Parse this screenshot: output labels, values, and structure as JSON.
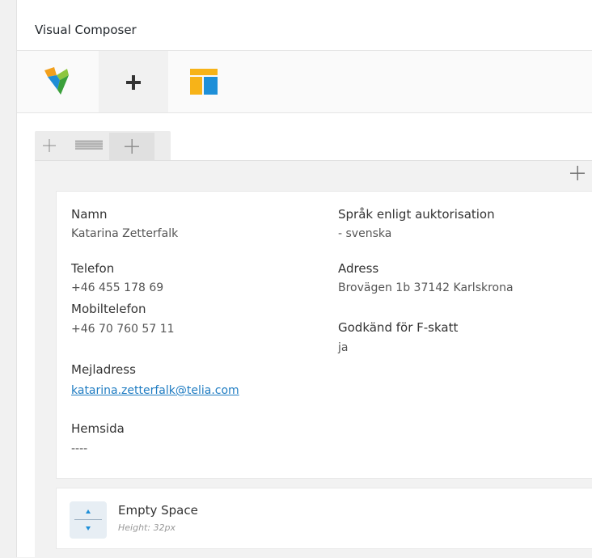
{
  "panel": {
    "title": "Visual Composer"
  },
  "toolbar": {
    "logo_icon": "vc-logo-icon",
    "add_icon": "plus-icon",
    "template_icon": "templates-icon"
  },
  "row": {
    "controls": {
      "move_icon": "move-icon",
      "layout_icon": "layout-icon",
      "add_icon": "plus-icon"
    },
    "column_add_icon": "plus-icon"
  },
  "text_block": {
    "left": [
      {
        "label": "Namn",
        "value": "Katarina Zetterfalk"
      },
      {
        "label": "Telefon",
        "value": "+46 455 178 69"
      },
      {
        "label": "Mobiltelefon",
        "value": "+46 70 760 57 11"
      },
      {
        "label": "Mejladress",
        "value": "katarina.zetterfalk@telia.com"
      },
      {
        "label": "Hemsida",
        "value": "----"
      }
    ],
    "right": [
      {
        "label": "Språk enligt auktorisation",
        "value": "- svenska"
      },
      {
        "label": "Adress",
        "value": "Brovägen 1b 37142 Karlskrona"
      },
      {
        "label": "Godkänd för F-skatt",
        "value": "ja"
      }
    ]
  },
  "empty_space": {
    "title": "Empty Space",
    "subtitle": "Height: 32px",
    "icon": "empty-space-icon"
  }
}
